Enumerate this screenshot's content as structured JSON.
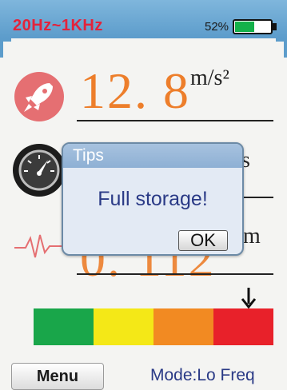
{
  "status_bar": {
    "frequency_range": "20Hz~1KHz",
    "battery_percent_label": "52%",
    "battery_level": 0.52
  },
  "readings": {
    "acceleration": {
      "value": "12. 8",
      "unit": "m/s²",
      "icon": "rocket-icon"
    },
    "velocity": {
      "unit": "s",
      "icon": "gauge-icon"
    },
    "displacement": {
      "value": "0. 112",
      "unit": "m",
      "icon": "waveform-icon"
    }
  },
  "dialog": {
    "title": "Tips",
    "message": "Full storage!",
    "ok_label": "OK"
  },
  "level_bar": {
    "colors": [
      "#19a64a",
      "#f4e817",
      "#f28a22",
      "#e8212a"
    ],
    "indicator_segment": 4
  },
  "footer": {
    "menu_label": "Menu",
    "mode_label": "Mode:Lo Freq"
  },
  "colors": {
    "accent_blue": "#5c9ccb",
    "value_orange": "#ed7e2b",
    "alert_red": "#e3233b"
  }
}
